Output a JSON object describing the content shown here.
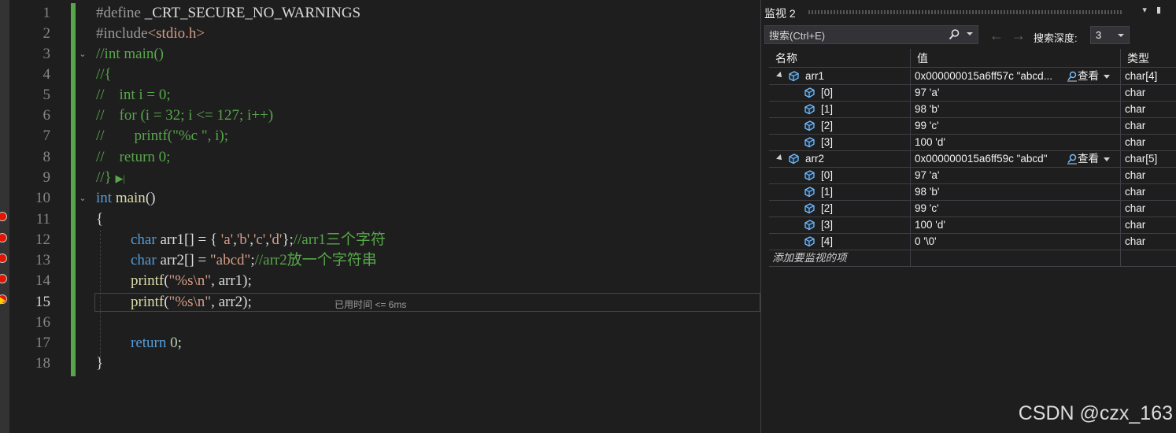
{
  "editor": {
    "line_numbers": [
      "1",
      "2",
      "3",
      "4",
      "5",
      "6",
      "7",
      "8",
      "9",
      "10",
      "11",
      "12",
      "13",
      "14",
      "15",
      "16",
      "17",
      "18"
    ],
    "active_line": "15",
    "lines": {
      "l1": {
        "a": "#define ",
        "b": "_CRT_SECURE_NO_WARNINGS"
      },
      "l2": {
        "a": "#include",
        "b": "<stdio.h>"
      },
      "l3": {
        "a": "//int main()"
      },
      "l4": {
        "a": "//{"
      },
      "l5": {
        "a": "//    int i = 0;"
      },
      "l6": {
        "a": "//    for (i = 32; i <= 127; i++)"
      },
      "l7": {
        "a": "//        printf(\"%c \", i);"
      },
      "l8": {
        "a": "//    return 0;"
      },
      "l9": {
        "a": "//}"
      },
      "l10": {
        "kw": "int",
        "fn": " main",
        "rest": "()"
      },
      "l11": {
        "a": "{"
      },
      "l12": {
        "kw": "char",
        "id": " arr1",
        "rest": "[] = { ",
        "s1": "'a'",
        "c1": ",",
        "s2": "'b'",
        "c2": ",",
        "s3": "'c'",
        "c3": ",",
        "s4": "'d'",
        "end": "};",
        "cm": "//arr1三个字符"
      },
      "l13": {
        "kw": "char",
        "id": " arr2",
        "rest": "[] = ",
        "s": "\"abcd\"",
        "end": ";",
        "cm": "//arr2放一个字符串"
      },
      "l14": {
        "fn": "printf",
        "open": "(",
        "s": "\"%s\\n\"",
        "rest": ", arr1);"
      },
      "l15": {
        "fn": "printf",
        "open": "(",
        "s": "\"%s\\n\"",
        "rest": ", arr2);"
      },
      "l16": {
        "a": ""
      },
      "l17": {
        "kw": "return",
        "num": " 0",
        "rest": ";"
      },
      "l18": {
        "a": "}"
      }
    },
    "elapsed_hint": "已用时间 <= 6ms"
  },
  "watch": {
    "title": "监视 2",
    "search_placeholder": "搜索(Ctrl+E)",
    "depth_label": "搜索深度:",
    "depth_value": "3",
    "columns": {
      "name": "名称",
      "value": "值",
      "type": "类型"
    },
    "rows": [
      {
        "name": "arr1",
        "value": "0x000000015a6ff57c \"abcd...",
        "type": "char[4]",
        "viewer": "查看"
      },
      {
        "name": "[0]",
        "value": "97 'a'",
        "type": "char"
      },
      {
        "name": "[1]",
        "value": "98 'b'",
        "type": "char"
      },
      {
        "name": "[2]",
        "value": "99 'c'",
        "type": "char"
      },
      {
        "name": "[3]",
        "value": "100 'd'",
        "type": "char"
      },
      {
        "name": "arr2",
        "value": "0x000000015a6ff59c \"abcd\"",
        "type": "char[5]",
        "viewer": "查看"
      },
      {
        "name": "[0]",
        "value": "97 'a'",
        "type": "char"
      },
      {
        "name": "[1]",
        "value": "98 'b'",
        "type": "char"
      },
      {
        "name": "[2]",
        "value": "99 'c'",
        "type": "char"
      },
      {
        "name": "[3]",
        "value": "100 'd'",
        "type": "char"
      },
      {
        "name": "[4]",
        "value": "0 '\\0'",
        "type": "char"
      }
    ],
    "add_item": "添加要监视的项"
  },
  "watermark": "CSDN @czx_163",
  "colors": {
    "keyword": "#569cd6",
    "comment": "#57a64a",
    "string": "#d69d85",
    "breakpoint": "#e51400",
    "current_line_arrow": "#ffcc00",
    "object_icon": "#75beff"
  }
}
